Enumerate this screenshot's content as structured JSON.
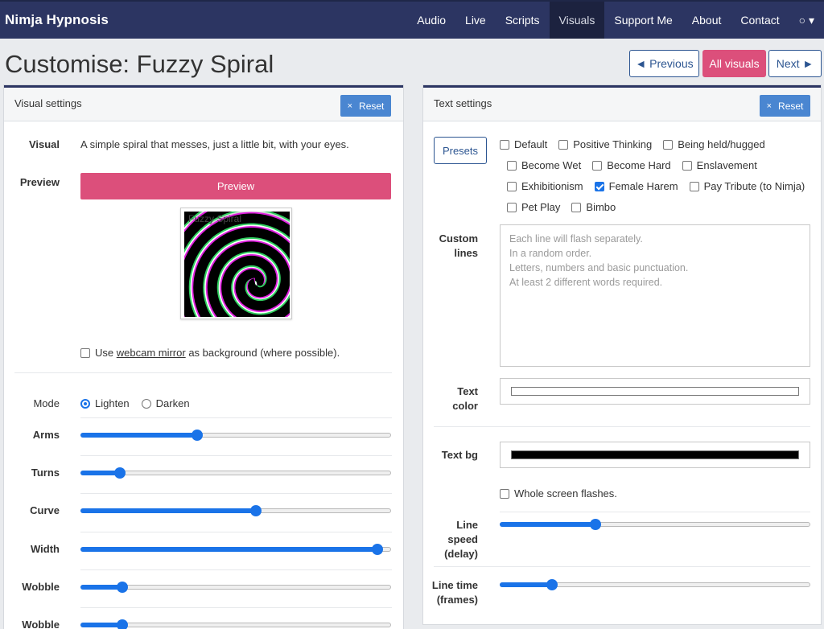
{
  "navbar": {
    "brand": "Nimja Hypnosis",
    "items": [
      "Audio",
      "Live",
      "Scripts",
      "Visuals",
      "Support Me",
      "About",
      "Contact",
      "○ ▾"
    ]
  },
  "header": {
    "title": "Customise: Fuzzy Spiral",
    "prev_label": "◄ Previous",
    "all_label": "All visuals",
    "next_label": "Next ►"
  },
  "visual_settings": {
    "title": "Visual settings",
    "reset_label": "Reset",
    "visual_label": "Visual",
    "visual_desc": "A simple spiral that messes, just a little bit, with your eyes.",
    "preview_label": "Preview",
    "preview_button": "Preview",
    "thumbnail_title": "Fuzzy Spiral",
    "webcam_prefix": "Use ",
    "webcam_link": "webcam mirror",
    "webcam_suffix": " as background (where possible).",
    "webcam_checked": false,
    "mode_label": "Mode",
    "mode_options": [
      "Lighten",
      "Darken"
    ],
    "mode_selected": "Lighten",
    "sliders": [
      {
        "label": "Arms",
        "value": 0.376
      },
      {
        "label": "Turns",
        "value": 0.128
      },
      {
        "label": "Curve",
        "value": 0.565
      },
      {
        "label": "Width",
        "value": 0.955
      },
      {
        "label": "Wobble",
        "value": 0.135
      },
      {
        "label": "Wobble",
        "value": 0.135
      }
    ]
  },
  "text_settings": {
    "title": "Text settings",
    "reset_label": "Reset",
    "presets_button": "Presets",
    "presets": [
      [
        {
          "label": "Default",
          "checked": false
        },
        {
          "label": "Positive Thinking",
          "checked": false
        },
        {
          "label": "Being held/hugged",
          "checked": false
        }
      ],
      [
        {
          "label": "Become Wet",
          "checked": false
        },
        {
          "label": "Become Hard",
          "checked": false
        },
        {
          "label": "Enslavement",
          "checked": false
        }
      ],
      [
        {
          "label": "Exhibitionism",
          "checked": false
        },
        {
          "label": "Female Harem",
          "checked": true
        },
        {
          "label": "Pay Tribute (to Nimja)",
          "checked": false
        }
      ],
      [
        {
          "label": "Pet Play",
          "checked": false
        },
        {
          "label": "Bimbo",
          "checked": false
        }
      ]
    ],
    "custom_lines_label_1": "Custom",
    "custom_lines_label_2": "lines",
    "custom_lines_placeholder": "Each line will flash separately.\nIn a random order.\nLetters, numbers and basic punctuation.\nAt least 2 different words required.",
    "text_color_label_1": "Text",
    "text_color_label_2": "color",
    "text_color": "#ffffff",
    "text_bg_label": "Text bg",
    "text_bg": "#000000",
    "whole_screen_label": "Whole screen flashes.",
    "whole_screen_checked": false,
    "line_speed_label": [
      "Line",
      "speed",
      "(delay)"
    ],
    "line_speed_value": 0.309,
    "line_time_label": [
      "Line time",
      "(frames)"
    ],
    "line_time_value": 0.169
  },
  "colors": {
    "navbar": "#2c3562",
    "accent_pink": "#dc4f7b",
    "accent_blue": "#4a86d1",
    "slider_blue": "#1a73e8"
  }
}
